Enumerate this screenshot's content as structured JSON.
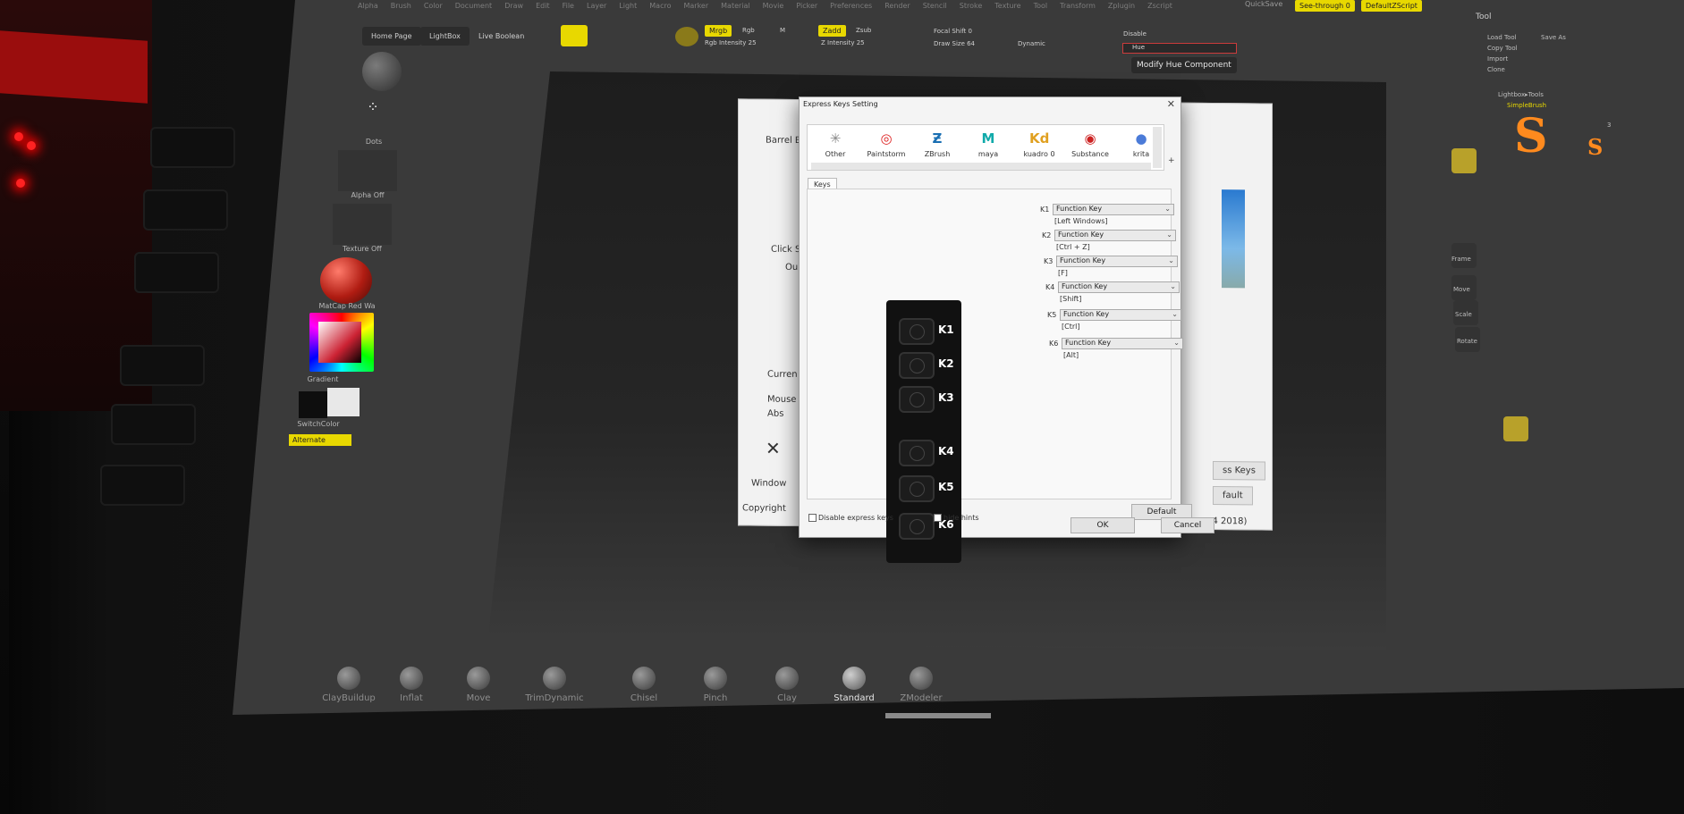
{
  "zbrush": {
    "menu": [
      "Alpha",
      "Brush",
      "Color",
      "Document",
      "Draw",
      "Edit",
      "File",
      "Layer",
      "Light",
      "Macro",
      "Marker",
      "Material",
      "Movie",
      "Picker",
      "Preferences",
      "Render",
      "Stencil",
      "Stroke",
      "Texture",
      "Tool",
      "Transform",
      "Zplugin",
      "Zscript"
    ],
    "quicksave": "QuickSave",
    "see_through": "See-through 0",
    "default_zscript": "DefaultZScript",
    "home_page": "Home Page",
    "lightbox": "LightBox",
    "live_boolean": "Live Boolean",
    "mrgb": "Mrgb",
    "rgb": "Rgb",
    "m": "M",
    "zadd": "Zadd",
    "zsub": "Zsub",
    "rgb_intensity": "Rgb Intensity 25",
    "z_intensity": "Z Intensity 25",
    "focal_shift": "Focal Shift 0",
    "draw_size": "Draw Size 64",
    "dynamic": "Dynamic",
    "disable": "Disable",
    "hue": "Hue",
    "hue_tooltip": "Modify Hue Component",
    "tool_label": "Tool",
    "left_shelf": {
      "dots": "Dots",
      "alpha_off": "Alpha Off",
      "texture_off": "Texture Off",
      "matcap": "MatCap Red Wa",
      "gradient": "Gradient",
      "switchcolor": "SwitchColor",
      "alternate": "Alternate"
    },
    "right_shelf": {
      "load_tool": "Load Tool",
      "save_as": "Save As",
      "copy_tool": "Copy Tool",
      "import": "Import",
      "clone": "Clone",
      "lightbox_tools": "Lightbox▸Tools",
      "simplebrush": "SimpleBrush",
      "frame": "Frame",
      "move": "Move",
      "scale": "Scale",
      "rotate": "Rotate",
      "brush_count": "3"
    },
    "brushes": [
      "ClayBuildup",
      "Inflat",
      "Move",
      "TrimDynamic",
      "Chisel",
      "Pinch",
      "Clay",
      "Standard",
      "ZModeler"
    ],
    "active_brush": "Standard"
  },
  "back_dialog": {
    "barrel": "Barrel B",
    "click": "Click S",
    "ou": "Ou",
    "current": "Curren",
    "mouse": "Mouse",
    "abs": "Abs",
    "window": "Window",
    "copyright": "Copyright",
    "express_keys": "ss Keys",
    "fault": "fault",
    "version": "n 4 2018)"
  },
  "dialog": {
    "title": "Express Keys Setting",
    "apps": [
      "Other",
      "Paintstorm",
      "ZBrush",
      "maya",
      "kuadro 0",
      "Substance",
      "krita"
    ],
    "tab": "Keys",
    "keys": [
      {
        "id": "K1",
        "label": "K1",
        "func": "Function Key",
        "desc": "[Left Windows]"
      },
      {
        "id": "K2",
        "label": "K2",
        "func": "Function Key",
        "desc": "[Ctrl + Z]"
      },
      {
        "id": "K3",
        "label": "K3",
        "func": "Function Key",
        "desc": "[F]"
      },
      {
        "id": "K4",
        "label": "K4",
        "func": "Function Key",
        "desc": "[Shift]"
      },
      {
        "id": "K5",
        "label": "K5",
        "func": "Function Key",
        "desc": "[Ctrl]"
      },
      {
        "id": "K6",
        "label": "K6",
        "func": "Function Key",
        "desc": "[Alt]"
      }
    ],
    "default_btn": "Default",
    "disable_express": "Disable express keys",
    "hide_hints": "hide hints",
    "ok": "OK",
    "cancel": "Cancel"
  }
}
